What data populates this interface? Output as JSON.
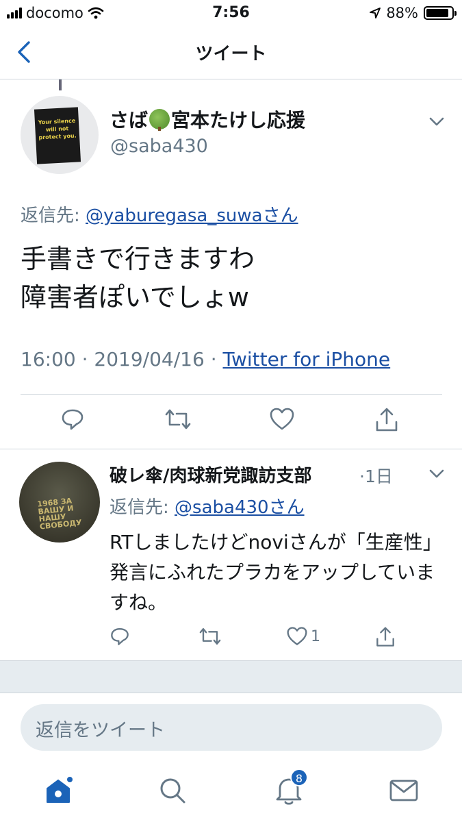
{
  "status_bar": {
    "carrier": "docomo",
    "time": "7:56",
    "battery_percent": "88%",
    "battery_level": 0.88
  },
  "header": {
    "title": "ツイート"
  },
  "main_tweet": {
    "display_name_part1": "さば",
    "display_name_part2": "宮本たけし応援",
    "handle": "@saba430",
    "reply_prefix": "返信先: ",
    "reply_target": "@yaburegasa_suwaさん",
    "text_line1": "手書きで行きますわ",
    "text_line2": "障害者ぽいでしょw",
    "time": "16:00",
    "date": "2019/04/16",
    "sep": " · ",
    "source": "Twitter for iPhone",
    "avatar_sign_text": "Your silence will not protect you."
  },
  "reply_tweet": {
    "display_name": "破レ傘/肉球新党諏訪支部",
    "time_ago": "·1日",
    "reply_prefix": "返信先: ",
    "reply_target": "@saba430さん",
    "text": "RTしましたけどnoviさんが「生産性」発言にふれたプラカをアップしていますね。",
    "like_count": "1",
    "avatar_text": "1968 ЗА ВАШУ И НАШУ СВОБОДУ"
  },
  "compose": {
    "placeholder": "返信をツイート"
  },
  "tabbar": {
    "notification_badge": "8"
  },
  "colors": {
    "link": "#1b4fa3",
    "accent": "#1b63b8",
    "secondary_text": "#657786",
    "divider": "#cfd6dc"
  },
  "icons": [
    "back-chevron-icon",
    "chevron-down-icon",
    "reply-icon",
    "retweet-icon",
    "like-icon",
    "share-icon",
    "home-icon",
    "search-icon",
    "notifications-icon",
    "messages-icon"
  ]
}
